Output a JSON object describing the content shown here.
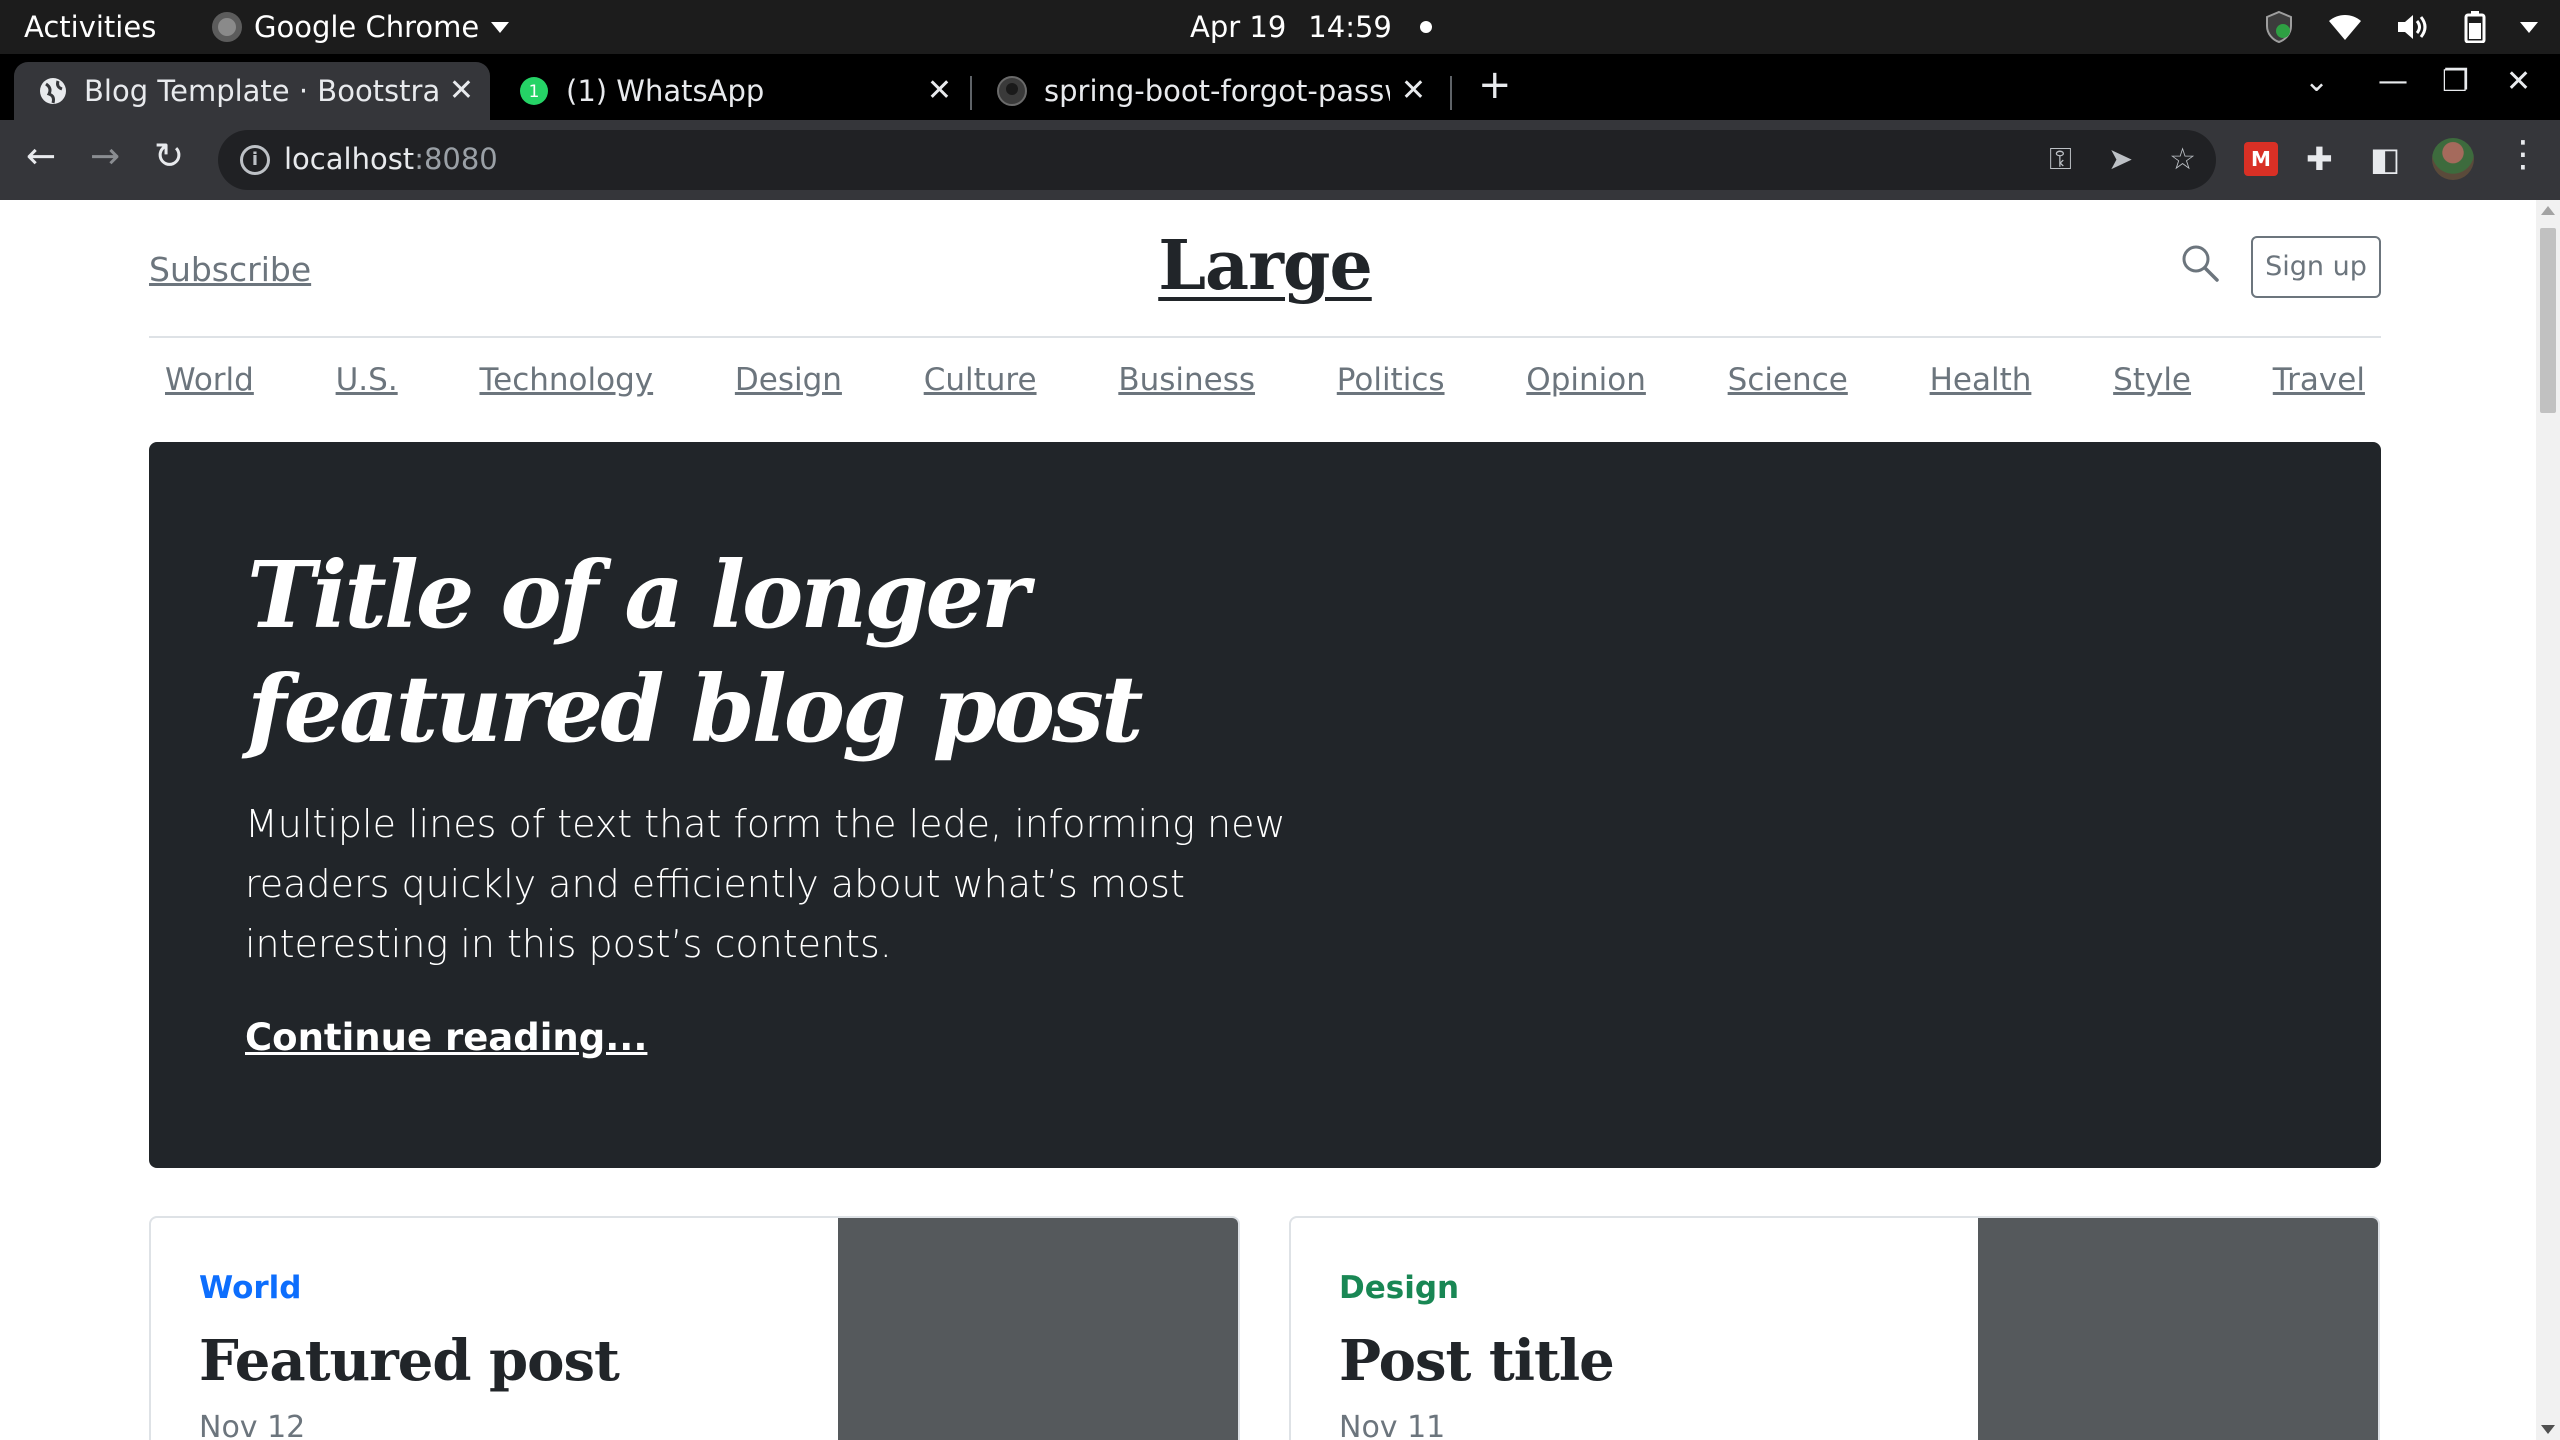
{
  "system_bar": {
    "activities": "Activities",
    "app_name": "Google Chrome",
    "date": "Apr 19",
    "time": "14:59"
  },
  "browser": {
    "tabs": [
      {
        "title": "Blog Template · Bootstrap",
        "icon": "globe-icon",
        "active": true
      },
      {
        "title": "(1) WhatsApp",
        "icon": "whatsapp-icon",
        "badge": "1",
        "active": false
      },
      {
        "title": "spring-boot-forgot-passw",
        "icon": "github-icon",
        "active": false
      }
    ],
    "url_host": "localhost",
    "url_port": ":8080"
  },
  "blog": {
    "subscribe": "Subscribe",
    "logo": "Large",
    "signup": "Sign up",
    "nav": [
      "World",
      "U.S.",
      "Technology",
      "Design",
      "Culture",
      "Business",
      "Politics",
      "Opinion",
      "Science",
      "Health",
      "Style",
      "Travel"
    ],
    "hero": {
      "title": "Title of a longer featured blog post",
      "lede": "Multiple lines of text that form the lede, informing new readers quickly and efficiently about what’s most interesting in this post’s contents.",
      "link": "Continue reading..."
    },
    "cards": [
      {
        "category": "World",
        "category_color": "#0d6efd",
        "title": "Featured post",
        "date": "Nov 12"
      },
      {
        "category": "Design",
        "category_color": "#198754",
        "title": "Post title",
        "date": "Nov 11"
      }
    ]
  },
  "colors": {
    "hero_bg": "#212529",
    "muted_text": "#6c757d",
    "thumb_bg": "#55595c"
  }
}
